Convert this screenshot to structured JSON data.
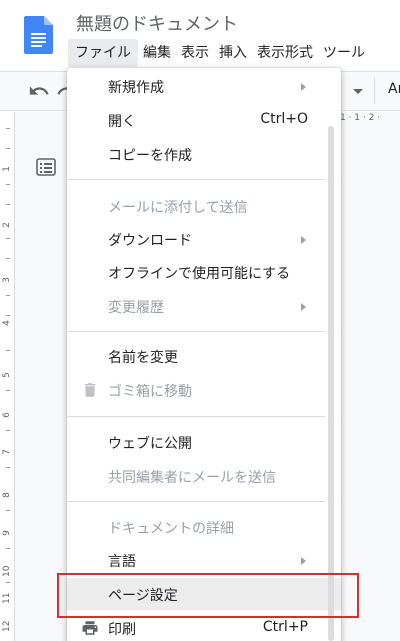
{
  "document": {
    "title": "無題のドキュメント"
  },
  "menubar": {
    "items": [
      "ファイル",
      "編集",
      "表示",
      "挿入",
      "表示形式",
      "ツール"
    ]
  },
  "toolbar": {
    "font_label": "Ar"
  },
  "ruler": {
    "top_marks": "1 · 1 · 2 ·",
    "side_marks": [
      "1",
      "2",
      "3",
      "4",
      "5",
      "6",
      "7",
      "8",
      "9",
      "10",
      "11",
      "12"
    ]
  },
  "file_menu": {
    "new_label": "新規作成",
    "open_label": "開く",
    "open_shortcut": "Ctrl+O",
    "copy_label": "コピーを作成",
    "email_attach_label": "メールに添付して送信",
    "download_label": "ダウンロード",
    "offline_label": "オフラインで使用可能にする",
    "history_label": "変更履歴",
    "rename_label": "名前を変更",
    "trash_label": "ゴミ箱に移動",
    "publish_label": "ウェブに公開",
    "email_collab_label": "共同編集者にメールを送信",
    "details_label": "ドキュメントの詳細",
    "language_label": "言語",
    "page_setup_label": "ページ設定",
    "print_label": "印刷",
    "print_shortcut": "Ctrl+P"
  },
  "colors": {
    "accent": "#4285f4",
    "highlight_border": "#d32f2f",
    "disabled_text": "#9aa0a6"
  },
  "icons": [
    "docs-logo-icon",
    "undo-icon",
    "redo-icon",
    "outline-icon",
    "trash-icon",
    "print-icon",
    "submenu-arrow-icon"
  ]
}
